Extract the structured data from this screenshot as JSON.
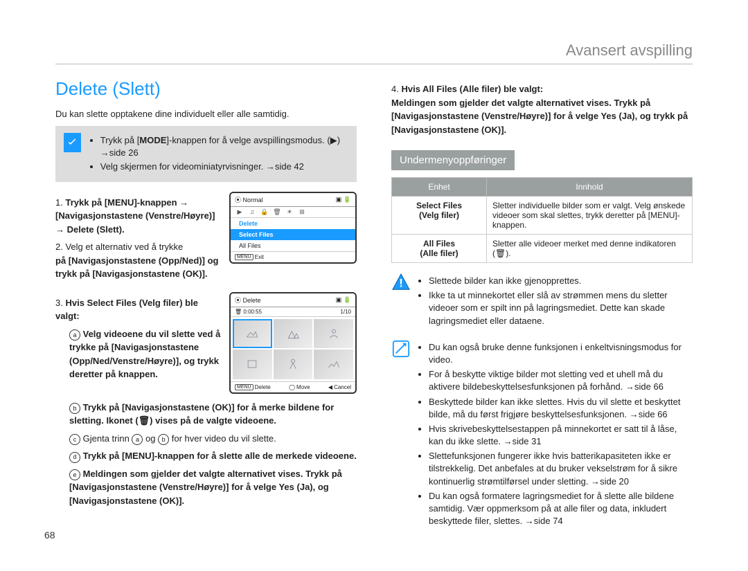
{
  "header": {
    "section": "Avansert avspilling"
  },
  "page_number": "68",
  "left": {
    "title": "Delete (Slett)",
    "intro": "Du kan slette opptakene dine individuelt eller alle samtidig.",
    "callout": {
      "line1_pre": "Trykk på [",
      "line1_key": "MODE",
      "line1_post": "]-knappen for å velge avspillingsmodus.",
      "line1_ref": "side 26",
      "line2": "Velg skjermen for videominiatyrvisninger.",
      "line2_ref": "side 42",
      "play_icon_title": "▶"
    },
    "screen1": {
      "title": "Normal",
      "menu_cat": "Delete",
      "menu_sel": "Select Files",
      "menu_other": "All Files",
      "footer_menu": "MENU",
      "footer_exit": "Exit"
    },
    "screen2": {
      "title": "Delete",
      "time": "0:00:55",
      "count": "1/10",
      "footer_menu": "MENU",
      "footer_del": "Delete",
      "footer_move": "Move",
      "footer_cancel": "Cancel"
    },
    "step1": "Trykk på [MENU]-knappen → [Navigasjonstastene (Venstre/Høyre)] → Delete (Slett).",
    "step2a": "Velg et alternativ ved å trykke",
    "step2b": "på [Navigasjonstastene (Opp/Ned)] og trykk på [Navigasjonstastene (OK)].",
    "step3_head": "Hvis Select Files (Velg filer) ble valgt:",
    "step3_a": "Velg videoene du vil slette ved å trykke på [Navigasjonstastene (Opp/Ned/Venstre/Høyre)], og trykk deretter på knappen.",
    "step3_b": "Trykk på [Navigasjonstastene (OK)] for å merke bildene for sletting. Ikonet (🗑) vises på de valgte videoene.",
    "step3_c_pre": "Gjenta trinn ",
    "step3_c_mid": " og ",
    "step3_c_post": " for hver video du vil slette.",
    "step3_d": "Trykk på [MENU]-knappen for å slette alle de merkede videoene.",
    "step3_e": "Meldingen som gjelder det valgte alternativet vises. Trykk på [Navigasjonstastene (Venstre/Høyre)] for å velge Yes (Ja), og [Navigasjonstastene (OK)].",
    "circ_a": "a",
    "circ_b": "b",
    "circ_c": "c",
    "circ_d": "d",
    "circ_e": "e"
  },
  "right": {
    "step4_head": "Hvis All Files (Alle filer) ble valgt:",
    "step4_body": "Meldingen som gjelder det valgte alternativet vises. Trykk på [Navigasjonstastene (Venstre/Høyre)] for å velge Yes (Ja), og trykk på [Navigasjonstastene (OK)].",
    "sub_heading": "Undermenyoppføringer",
    "table": {
      "head1": "Enhet",
      "head2": "Innhold",
      "row1_unit_a": "Select Files",
      "row1_unit_b": "(Velg filer)",
      "row1_body": "Sletter individuelle bilder som er valgt. Velg ønskede videoer som skal slettes, trykk deretter på [MENU]-knappen.",
      "row2_unit_a": "All Files",
      "row2_unit_b": "(Alle filer)",
      "row2_body": "Sletter alle videoer merket med denne indikatoren (🗑)."
    },
    "warn": {
      "b1": "Slettede bilder kan ikke gjenopprettes.",
      "b2": "Ikke ta ut minnekortet eller slå av strømmen mens du sletter videoer som er spilt inn på lagringsmediet. Dette kan skade lagringsmediet eller dataene."
    },
    "note": {
      "b1": "Du kan også bruke denne funksjonen i enkeltvisningsmodus for video.",
      "b2": "For å beskytte viktige bilder mot sletting ved et uhell må du aktivere bildebeskyttelsesfunksjonen på forhånd. →side 66",
      "b3": "Beskyttede bilder kan ikke slettes. Hvis du vil slette et beskyttet bilde, må du først frigjøre beskyttelsesfunksjonen. →side 66",
      "b4": "Hvis skrivebeskyttelsestappen på minnekortet er satt til å låse, kan du ikke slette. →side 31",
      "b5": "Slettefunksjonen fungerer ikke hvis batterikapasiteten ikke er tilstrekkelig. Det anbefales at du bruker vekselstrøm for å sikre kontinuerlig strømtilførsel under sletting. →side 20",
      "b6": "Du kan også formatere lagringsmediet for å slette alle bildene samtidig. Vær oppmerksom på at alle filer og data, inkludert beskyttede filer, slettes. →side 74"
    }
  }
}
